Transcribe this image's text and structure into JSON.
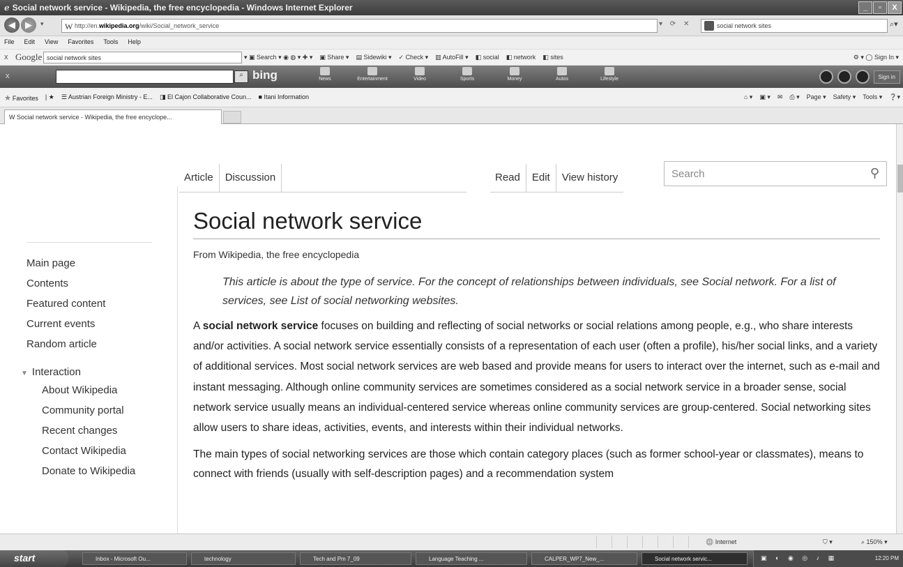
{
  "window": {
    "title": "Social network service - Wikipedia, the free encyclopedia - Windows Internet Explorer",
    "min": "_",
    "max": "▫",
    "close": "X"
  },
  "address": {
    "url_prefix": "http://en.",
    "url_domain": "wikipedia.org",
    "url_path": "/wiki/Social_network_service",
    "search_text": "social network sites"
  },
  "menu": [
    "File",
    "Edit",
    "View",
    "Favorites",
    "Tools",
    "Help"
  ],
  "google_toolbar": {
    "logo": "Google",
    "query": "social network sites",
    "items": [
      "Search",
      "Share",
      "Sidewiki",
      "Check",
      "AutoFill",
      "social",
      "network",
      "sites"
    ],
    "signin": "Sign In"
  },
  "bing_toolbar": {
    "logo": "bing",
    "items": [
      "News",
      "Entertainment",
      "Video",
      "Sports",
      "Money",
      "Autos",
      "Lifestyle"
    ],
    "signin": "Sign in"
  },
  "favorites": {
    "label": "Favorites",
    "items": [
      "Austrian Foreign Ministry - E...",
      "El Cajon Collaborative Coun...",
      "Itani Information"
    ],
    "commands": [
      "Page",
      "Safety",
      "Tools"
    ]
  },
  "tab": {
    "label": "Social network service - Wikipedia, the free encyclope..."
  },
  "wiki": {
    "tabs_left": [
      "Article",
      "Discussion"
    ],
    "tabs_right": [
      "Read",
      "Edit",
      "View history"
    ],
    "search_placeholder": "Search",
    "title": "Social network service",
    "site_sub": "From Wikipedia, the free encyclopedia",
    "hatnote": "This article is about the type of service. For the concept of relationships between individuals, see Social network. For a list of services, see List of social networking websites.",
    "lead_bold": "social network service",
    "lead_prefix": "A",
    "lead_rest": "focuses on building and reflecting of social networks or social relations among people, e.g., who share interests and/or activities. A social network service essentially consists of a representation of each user (often a profile), his/her social links, and a variety of additional services. Most social network services are web based and provide means for users to interact over the internet, such as e-mail and instant messaging. Although online community services are sometimes considered as a social network service in a broader sense, social network service usually means an individual-centered service whereas online community services are group-centered. Social networking sites allow users to share ideas, activities, events, and interests within their individual networks.",
    "para2": "The main types of social networking services are those which contain category places (such as former school-year or classmates), means to connect with friends (usually with self-description pages) and a recommendation system"
  },
  "sidebar": {
    "nav": [
      "Main page",
      "Contents",
      "Featured content",
      "Current events",
      "Random article"
    ],
    "interaction_label": "Interaction",
    "interaction": [
      "About Wikipedia",
      "Community portal",
      "Recent changes",
      "Contact Wikipedia",
      "Donate to Wikipedia"
    ]
  },
  "status": {
    "zone": "Internet",
    "zoom": "150%"
  },
  "taskbar": {
    "start": "start",
    "tasks": [
      "Inbox - Microsoft Ou...",
      "technology",
      "Tech and Pm 7_09",
      "Language Teaching ...",
      "CALPER_WP7_New_...",
      "Social network servic..."
    ],
    "clock": "12:20 PM"
  }
}
